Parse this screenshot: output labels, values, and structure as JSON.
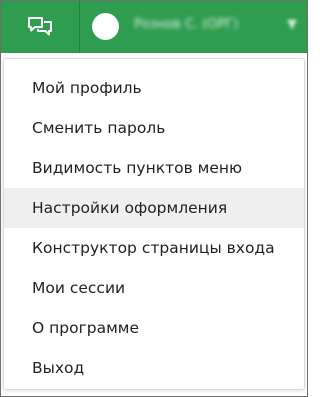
{
  "colors": {
    "topbar": "#2e9d4f",
    "menu_hover": "#efefef",
    "menu_text": "#222222"
  },
  "topbar": {
    "chat_icon": "chat-bubbles-icon",
    "user": {
      "avatar_icon": "avatar",
      "name": "Рознов С. (ОРГ)",
      "chevron_icon": "chevron-down-icon"
    }
  },
  "menu": {
    "items": [
      {
        "label": "Мой профиль"
      },
      {
        "label": "Сменить пароль"
      },
      {
        "label": "Видимость пунктов меню"
      },
      {
        "label": "Настройки оформления",
        "hovered": true
      },
      {
        "label": "Конструктор страницы входа"
      },
      {
        "label": "Мои сессии"
      },
      {
        "label": "О программе"
      },
      {
        "label": "Выход"
      }
    ]
  }
}
